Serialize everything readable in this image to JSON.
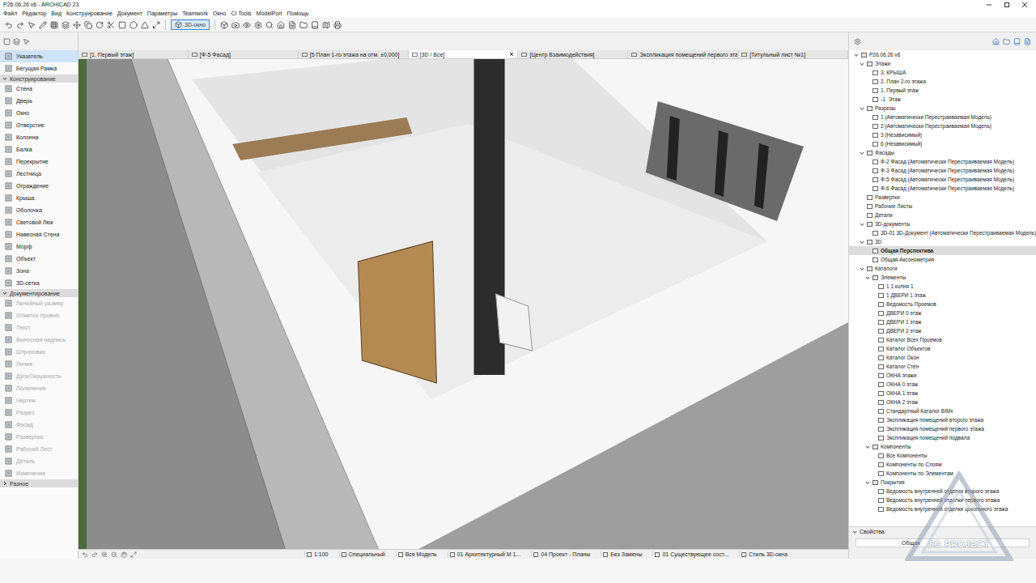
{
  "window": {
    "title": "P26.06.26 v6 - ARCHICAD 23"
  },
  "menu": [
    "Файл",
    "Редактор",
    "Вид",
    "Конструирование",
    "Документ",
    "Параметры",
    "Teamwork",
    "Окно",
    "CI Tools",
    "ModelPort",
    "Помощь"
  ],
  "toolbar": {
    "view_button": {
      "label": "3D-окно",
      "selected": true
    }
  },
  "tabs": [
    {
      "label": "[1. Первый этаж]",
      "selected": false
    },
    {
      "label": "[Ф-5 Фасад]",
      "selected": false
    },
    {
      "label": "[5 План 1-го этажа на отм. ±0,000]",
      "selected": false
    },
    {
      "label": "[3D / Все]",
      "selected": true
    },
    {
      "label": "[Центр Взаимодействия]",
      "selected": false
    },
    {
      "label": "Экспликация помещений первого эта",
      "selected": false
    },
    {
      "label": "[Титульный лист №1]",
      "selected": false
    }
  ],
  "toolbox": {
    "top_items": [
      {
        "label": "Указатель",
        "selected": true,
        "disabled": false
      },
      {
        "label": "Бегущая Рамка",
        "selected": false,
        "disabled": false
      }
    ],
    "sections": [
      {
        "title": "Конструирование",
        "expanded": true,
        "items": [
          {
            "label": "Стена",
            "selected": false,
            "disabled": false
          },
          {
            "label": "Дверь",
            "selected": false,
            "disabled": false
          },
          {
            "label": "Окно",
            "selected": false,
            "disabled": false
          },
          {
            "label": "Отверстие",
            "selected": false,
            "disabled": false
          },
          {
            "label": "Колонна",
            "selected": false,
            "disabled": false
          },
          {
            "label": "Балка",
            "selected": false,
            "disabled": false
          },
          {
            "label": "Перекрытие",
            "selected": false,
            "disabled": false
          },
          {
            "label": "Лестница",
            "selected": false,
            "disabled": false
          },
          {
            "label": "Ограждение",
            "selected": false,
            "disabled": false
          },
          {
            "label": "Крыша",
            "selected": false,
            "disabled": false
          },
          {
            "label": "Оболочка",
            "selected": false,
            "disabled": false
          },
          {
            "label": "Световой Люк",
            "selected": false,
            "disabled": false
          },
          {
            "label": "Навесная Стена",
            "selected": false,
            "disabled": false
          },
          {
            "label": "Морф",
            "selected": false,
            "disabled": false
          },
          {
            "label": "Объект",
            "selected": false,
            "disabled": false
          },
          {
            "label": "Зона",
            "selected": false,
            "disabled": false
          },
          {
            "label": "3D-сетка",
            "selected": false,
            "disabled": false
          }
        ]
      },
      {
        "title": "Документирование",
        "expanded": true,
        "items": [
          {
            "label": "Линейный размер",
            "selected": false,
            "disabled": true
          },
          {
            "label": "Отметка Уровня",
            "selected": false,
            "disabled": true
          },
          {
            "label": "Текст",
            "selected": false,
            "disabled": true
          },
          {
            "label": "Выносная надпись",
            "selected": false,
            "disabled": true
          },
          {
            "label": "Штриховка",
            "selected": false,
            "disabled": true
          },
          {
            "label": "Линия",
            "selected": false,
            "disabled": true
          },
          {
            "label": "Дуга/Окружность",
            "selected": false,
            "disabled": true
          },
          {
            "label": "Полилиния",
            "selected": false,
            "disabled": true
          },
          {
            "label": "Чертеж",
            "selected": false,
            "disabled": true
          },
          {
            "label": "Разрез",
            "selected": false,
            "disabled": true
          },
          {
            "label": "Фасад",
            "selected": false,
            "disabled": true
          },
          {
            "label": "Развертка",
            "selected": false,
            "disabled": true
          },
          {
            "label": "Рабочий Лист",
            "selected": false,
            "disabled": true
          },
          {
            "label": "Деталь",
            "selected": false,
            "disabled": true
          },
          {
            "label": "Изменение",
            "selected": false,
            "disabled": true
          }
        ]
      },
      {
        "title": "Разное",
        "expanded": false,
        "items": []
      }
    ]
  },
  "navigator": [
    {
      "label": "P26.06.26 v6",
      "level": 0,
      "kind": "folder",
      "expanded": true,
      "selected": false
    },
    {
      "label": "Этажи",
      "level": 1,
      "kind": "folder",
      "expanded": true,
      "selected": false
    },
    {
      "label": "3. КРЫША",
      "level": 2,
      "kind": "leaf",
      "expanded": false,
      "selected": false
    },
    {
      "label": "2. План 2-го этажа",
      "level": 2,
      "kind": "leaf",
      "expanded": false,
      "selected": false
    },
    {
      "label": "1. Первый этаж",
      "level": 2,
      "kind": "leaf",
      "expanded": false,
      "selected": false
    },
    {
      "label": "-1. Этаж",
      "level": 2,
      "kind": "leaf",
      "expanded": false,
      "selected": false
    },
    {
      "label": "Разрезы",
      "level": 1,
      "kind": "folder",
      "expanded": true,
      "selected": false
    },
    {
      "label": "1 (Автоматически Перестраиваемая Модель)",
      "level": 2,
      "kind": "leaf",
      "expanded": false,
      "selected": false
    },
    {
      "label": "2 (Автоматически Перестраиваемая Модель)",
      "level": 2,
      "kind": "leaf",
      "expanded": false,
      "selected": false
    },
    {
      "label": "3 (Независимый)",
      "level": 2,
      "kind": "leaf",
      "expanded": false,
      "selected": false
    },
    {
      "label": "6 (Независимый)",
      "level": 2,
      "kind": "leaf",
      "expanded": false,
      "selected": false
    },
    {
      "label": "Фасады",
      "level": 1,
      "kind": "folder",
      "expanded": true,
      "selected": false
    },
    {
      "label": "Ф-2 Фасад (Автоматически Перестраиваемая Модель)",
      "level": 2,
      "kind": "leaf",
      "expanded": false,
      "selected": false
    },
    {
      "label": "Ф-3 Фасад (Автоматически Перестраиваемая Модель)",
      "level": 2,
      "kind": "leaf",
      "expanded": false,
      "selected": false
    },
    {
      "label": "Ф-5 Фасад (Автоматически Перестраиваемая Модель)",
      "level": 2,
      "kind": "leaf",
      "expanded": false,
      "selected": false
    },
    {
      "label": "Ф-6 Фасад (Автоматически Перестраиваемая Модель)",
      "level": 2,
      "kind": "leaf",
      "expanded": false,
      "selected": false
    },
    {
      "label": "Развертки",
      "level": 1,
      "kind": "leaf",
      "expanded": false,
      "selected": false
    },
    {
      "label": "Рабочие Листы",
      "level": 1,
      "kind": "leaf",
      "expanded": false,
      "selected": false
    },
    {
      "label": "Детали",
      "level": 1,
      "kind": "leaf",
      "expanded": false,
      "selected": false
    },
    {
      "label": "3D-документы",
      "level": 1,
      "kind": "folder",
      "expanded": true,
      "selected": false
    },
    {
      "label": "3D-01 3D-Документ (Автоматически Перестраиваемая Модель)",
      "level": 2,
      "kind": "leaf",
      "expanded": false,
      "selected": false
    },
    {
      "label": "3D",
      "level": 1,
      "kind": "folder",
      "expanded": true,
      "selected": false
    },
    {
      "label": "Общая Перспектива",
      "level": 2,
      "kind": "leaf",
      "expanded": false,
      "selected": true
    },
    {
      "label": "Общая Аксонометрия",
      "level": 2,
      "kind": "leaf",
      "expanded": false,
      "selected": false
    },
    {
      "label": "Каталоги",
      "level": 1,
      "kind": "folder",
      "expanded": true,
      "selected": false
    },
    {
      "label": "Элементы",
      "level": 2,
      "kind": "folder",
      "expanded": true,
      "selected": false
    },
    {
      "label": "1 1 колня 1",
      "level": 3,
      "kind": "leaf",
      "expanded": false,
      "selected": false
    },
    {
      "label": "1 ДВЕРИ 1 этаж",
      "level": 3,
      "kind": "leaf",
      "expanded": false,
      "selected": false
    },
    {
      "label": "Ведомость Проемов",
      "level": 3,
      "kind": "leaf",
      "expanded": false,
      "selected": false
    },
    {
      "label": "ДВЕРИ 0 этаж",
      "level": 3,
      "kind": "leaf",
      "expanded": false,
      "selected": false
    },
    {
      "label": "ДВЕРИ 1 этаж",
      "level": 3,
      "kind": "leaf",
      "expanded": false,
      "selected": false
    },
    {
      "label": "ДВЕРИ 2 этаж",
      "level": 3,
      "kind": "leaf",
      "expanded": false,
      "selected": false
    },
    {
      "label": "Каталог Всех Проемов",
      "level": 3,
      "kind": "leaf",
      "expanded": false,
      "selected": false
    },
    {
      "label": "Каталог Объектов",
      "level": 3,
      "kind": "leaf",
      "expanded": false,
      "selected": false
    },
    {
      "label": "Каталог Окон",
      "level": 3,
      "kind": "leaf",
      "expanded": false,
      "selected": false
    },
    {
      "label": "Каталог Стен",
      "level": 3,
      "kind": "leaf",
      "expanded": false,
      "selected": false
    },
    {
      "label": "ОКНА этажи",
      "level": 3,
      "kind": "leaf",
      "expanded": false,
      "selected": false
    },
    {
      "label": "ОКНА 0 этаж",
      "level": 3,
      "kind": "leaf",
      "expanded": false,
      "selected": false
    },
    {
      "label": "ОКНА 1 этаж",
      "level": 3,
      "kind": "leaf",
      "expanded": false,
      "selected": false
    },
    {
      "label": "ОКНА 2 этаж",
      "level": 3,
      "kind": "leaf",
      "expanded": false,
      "selected": false
    },
    {
      "label": "Стандартный Каталог BIMx",
      "level": 3,
      "kind": "leaf",
      "expanded": false,
      "selected": false
    },
    {
      "label": "Экспликация помещений второго этажа",
      "level": 3,
      "kind": "leaf",
      "expanded": false,
      "selected": false
    },
    {
      "label": "Экспликация помещений первого этажа",
      "level": 3,
      "kind": "leaf",
      "expanded": false,
      "selected": false
    },
    {
      "label": "Экспликация помещений подвала",
      "level": 3,
      "kind": "leaf",
      "expanded": false,
      "selected": false
    },
    {
      "label": "Компоненты",
      "level": 2,
      "kind": "folder",
      "expanded": true,
      "selected": false
    },
    {
      "label": "Все Компоненты",
      "level": 3,
      "kind": "leaf",
      "expanded": false,
      "selected": false
    },
    {
      "label": "Компоненты по Слоям",
      "level": 3,
      "kind": "leaf",
      "expanded": false,
      "selected": false
    },
    {
      "label": "Компоненты по Элементам",
      "level": 3,
      "kind": "leaf",
      "expanded": false,
      "selected": false
    },
    {
      "label": "Покрытия",
      "level": 2,
      "kind": "folder",
      "expanded": true,
      "selected": false
    },
    {
      "label": "Ведомость внутренней отделки второго этажа",
      "level": 3,
      "kind": "leaf",
      "expanded": false,
      "selected": false
    },
    {
      "label": "Ведомость внутренней отделки первого этажа",
      "level": 3,
      "kind": "leaf",
      "expanded": false,
      "selected": false
    },
    {
      "label": "Ведомость внутренней отделки цокольного этажа",
      "level": 3,
      "kind": "leaf",
      "expanded": false,
      "selected": false
    }
  ],
  "properties": {
    "title": "Свойства",
    "expanded": true,
    "value": "Общая"
  },
  "status_bar": [
    "1:100",
    "Специальный",
    "Вся Модель",
    "01 Архитектурный М 1...",
    "04 Проект - Планы",
    "Без Замены",
    "01 Существующее сост...",
    "Стиль 3D-окна"
  ],
  "watermark": {
    "text": "5G PROJECT"
  }
}
